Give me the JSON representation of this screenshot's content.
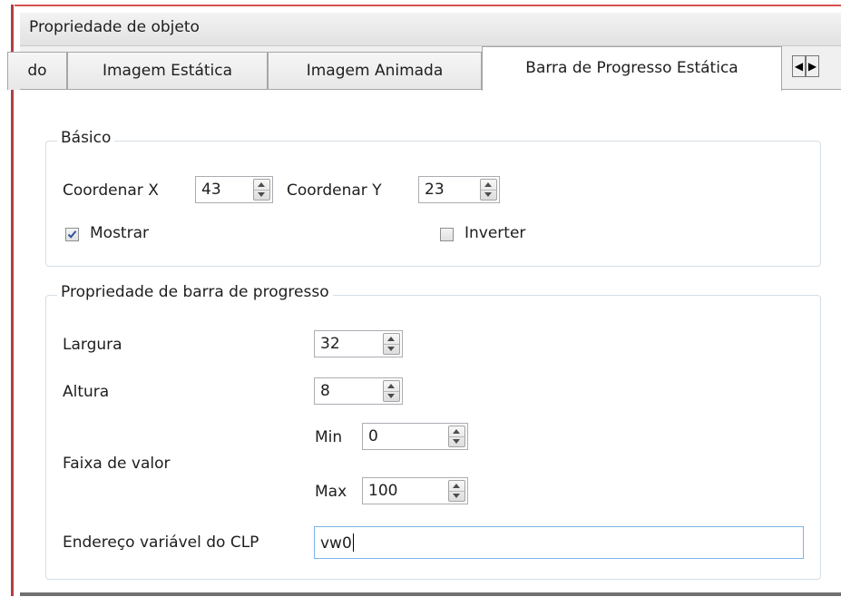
{
  "window": {
    "title": "Propriedade de objeto"
  },
  "tabs": [
    {
      "label": "do",
      "active": false
    },
    {
      "label": "Imagem Estática",
      "active": false
    },
    {
      "label": "Imagem Animada",
      "active": false
    },
    {
      "label": "Barra de Progresso Estática",
      "active": true
    }
  ],
  "tab_scroll": {
    "left_icon": "arrow-left-icon",
    "right_icon": "arrow-right-icon"
  },
  "basic_group": {
    "title": "Básico",
    "coord_x_label": "Coordenar X",
    "coord_x_value": "43",
    "coord_y_label": "Coordenar Y",
    "coord_y_value": "23",
    "show_label": "Mostrar",
    "show_checked": true,
    "invert_label": "Inverter",
    "invert_checked": false
  },
  "progress_group": {
    "title": "Propriedade de barra de progresso",
    "width_label": "Largura",
    "width_value": "32",
    "height_label": "Altura",
    "height_value": "8",
    "range_label": "Faixa de valor",
    "min_label": "Min",
    "min_value": "0",
    "max_label": "Max",
    "max_value": "100",
    "address_label": "Endereço variável do CLP",
    "address_value": "vw0"
  },
  "colors": {
    "panel_bg": "#f0f0f0",
    "content_bg": "#ffffff",
    "group_border": "#d5dfe5",
    "input_focus_border": "#7eb4ea",
    "window_edge_red": "#d95050"
  }
}
